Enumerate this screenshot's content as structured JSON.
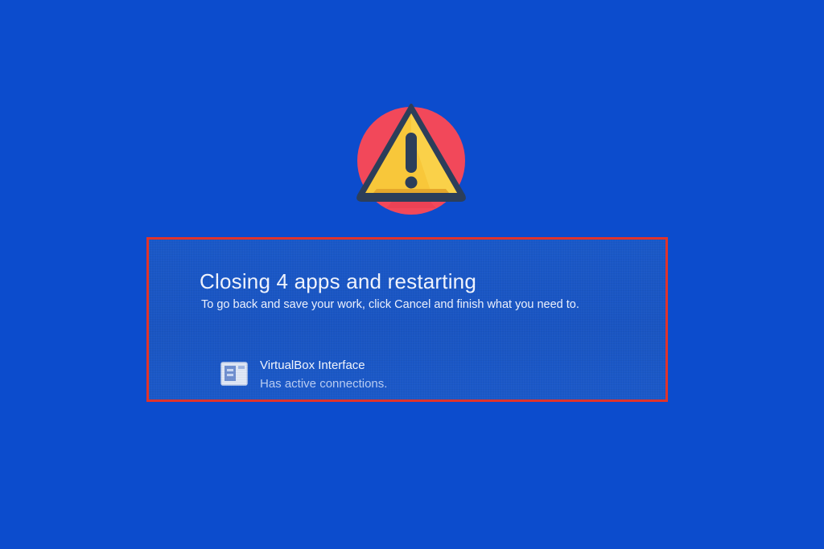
{
  "colors": {
    "background": "#0c4ccd",
    "highlight_border": "#e0332b",
    "badge_circle": "#f2485a",
    "warning_triangle": "#f8c73a",
    "warning_outline": "#2c3e5a"
  },
  "icons": {
    "badge": "warning-icon",
    "app": "app-window-icon"
  },
  "dialog": {
    "title": "Closing 4 apps and restarting",
    "subtitle": "To go back and save your work, click Cancel and finish what you need to.",
    "apps": [
      {
        "name": "VirtualBox Interface",
        "status": "Has active connections."
      }
    ]
  }
}
